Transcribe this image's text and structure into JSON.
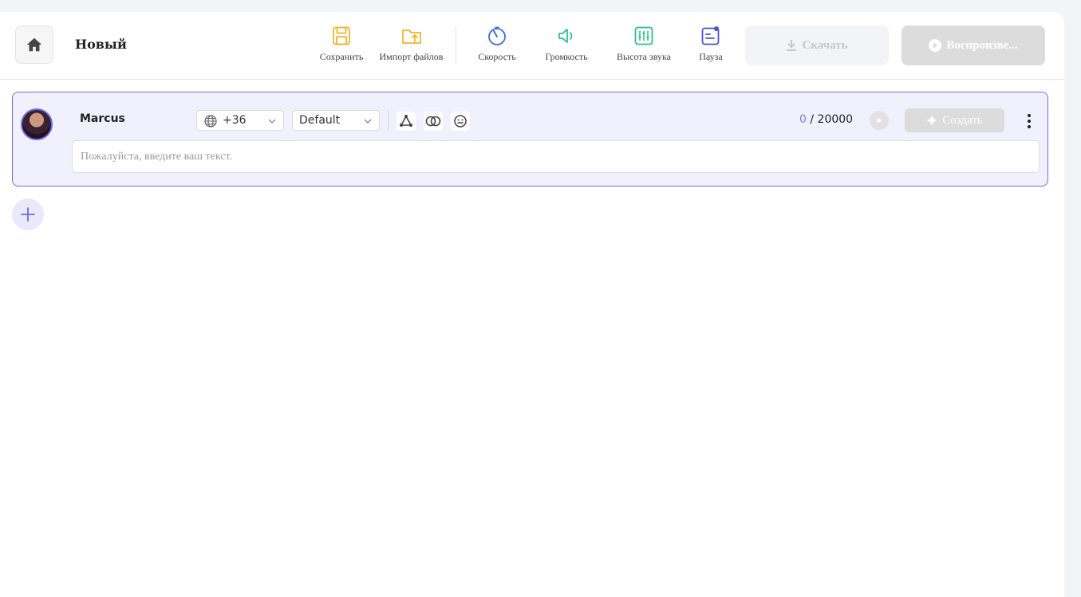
{
  "header": {
    "project_title": "Новый",
    "tools": [
      {
        "label": "Сохранить",
        "icon": "save-icon",
        "color": "#f0b429"
      },
      {
        "label": "Импорт файлов",
        "icon": "folder-import-icon",
        "color": "#f0b429"
      },
      {
        "label": "Скорость",
        "icon": "speed-timer-icon",
        "color": "#3b6fe0"
      },
      {
        "label": "Громкость",
        "icon": "volume-icon",
        "color": "#2cc38d"
      },
      {
        "label": "Высота звука",
        "icon": "pitch-sliders-icon",
        "color": "#2cc38d"
      },
      {
        "label": "Пауза",
        "icon": "pause-icon",
        "color": "#4c52d6"
      }
    ],
    "download_label": "Скачать",
    "play_all_label": "Воспроизве..."
  },
  "card": {
    "speaker_name": "Marcus",
    "language": "+36",
    "style": "Default",
    "char_count": "0",
    "char_limit": "20000",
    "create_label": "Создать",
    "text_placeholder": "Пожалуйста, введите ваш текст.",
    "text_value": ""
  },
  "colors": {
    "accent": "#6b6ee0",
    "card_bg": "#f1f1fe"
  }
}
